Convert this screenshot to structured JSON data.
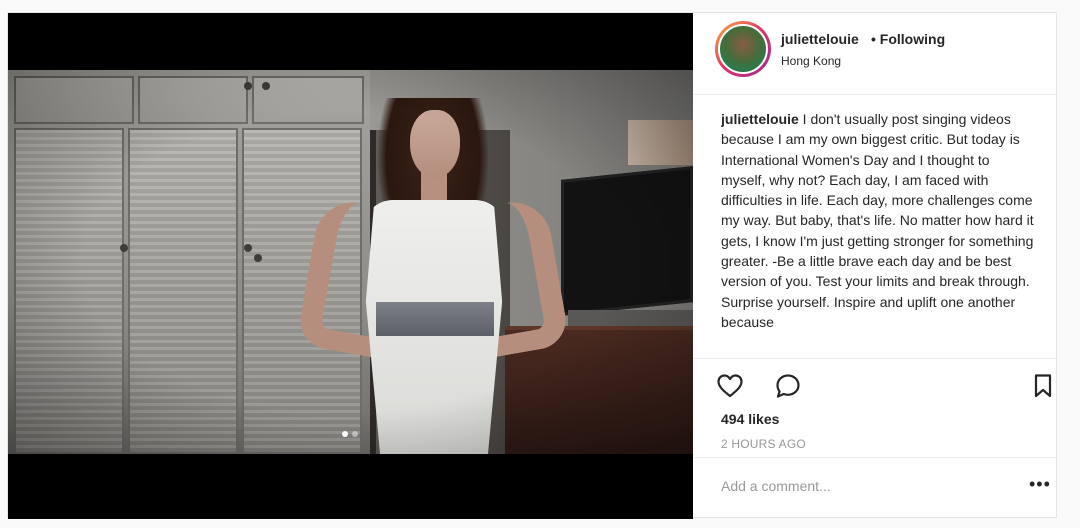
{
  "post": {
    "username": "juliettelouie",
    "separator": " • ",
    "follow_status": "Following",
    "location": "Hong Kong",
    "caption_username": "juliettelouie",
    "caption_text": " I don't usually post singing videos because I am my own biggest critic. But today is International Women's Day and I thought to myself, why not? Each day, I am faced with difficulties in life. Each day, more challenges come my way. But baby, that's life. No matter how hard it gets, I know I'm just getting stronger for something greater. -Be a little brave each day and be best version of you. Test your limits and break through. Surprise yourself. Inspire and uplift one another because",
    "likes": "494 likes",
    "timestamp": "2 HOURS AGO",
    "comment_placeholder": "Add a comment...",
    "more_label": "•••",
    "carousel": {
      "count": 2,
      "active_index": 0
    }
  },
  "icons": {
    "like": "heart-icon",
    "comment": "comment-bubble-icon",
    "save": "bookmark-icon",
    "more": "more-options-icon"
  },
  "colors": {
    "text": "#262626",
    "muted": "#999999",
    "border": "#efefef",
    "avatar_ring": [
      "#f7b23b",
      "#e1306c",
      "#9b2d8e"
    ]
  }
}
